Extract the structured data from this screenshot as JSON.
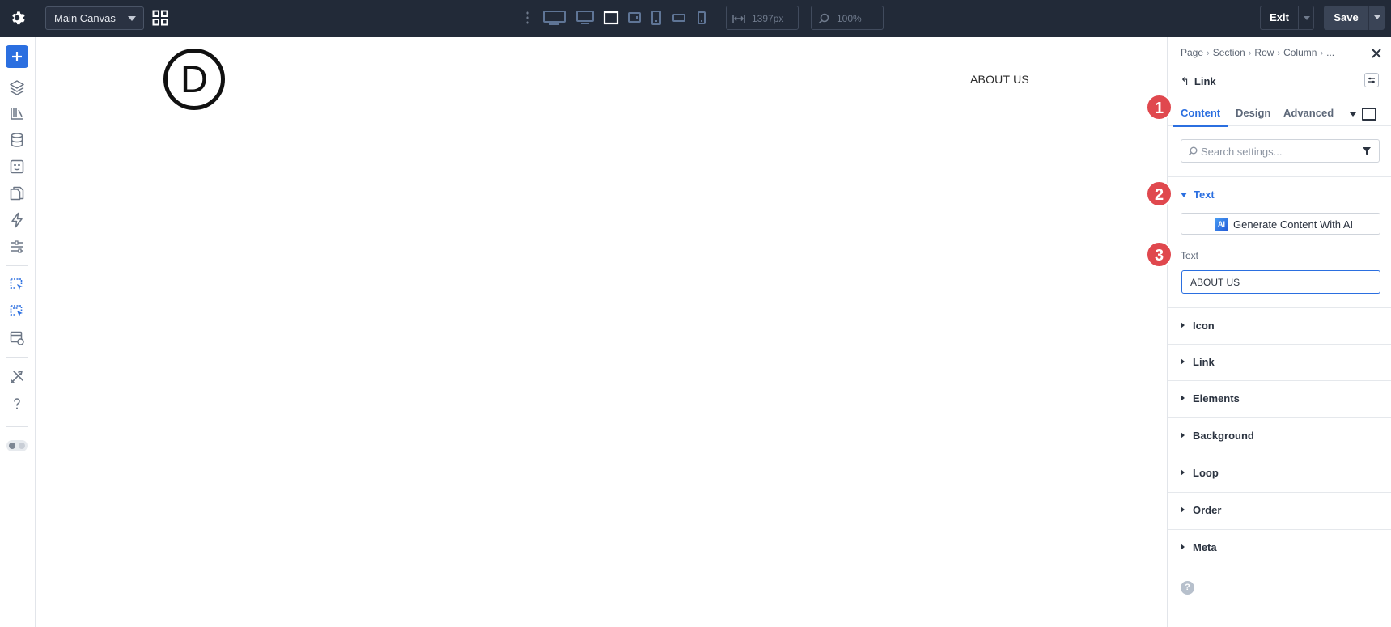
{
  "topbar": {
    "canvas_select": "Main Canvas",
    "width_value": "1397px",
    "zoom_value": "100%",
    "exit_label": "Exit",
    "save_label": "Save",
    "background_color": "#222a38"
  },
  "canvas": {
    "logo_letter": "D",
    "nav_link": "ABOUT US"
  },
  "panel": {
    "breadcrumb": [
      "Page",
      "Section",
      "Row",
      "Column",
      "..."
    ],
    "module_title": "Link",
    "tabs": [
      "Content",
      "Design",
      "Advanced"
    ],
    "active_tab": "Content",
    "search_placeholder": "Search settings...",
    "open_group": "Text",
    "ai_badge": "AI",
    "ai_button": "Generate Content With AI",
    "field_label": "Text",
    "field_value": "ABOUT US",
    "groups": [
      "Icon",
      "Link",
      "Elements",
      "Background",
      "Loop",
      "Order",
      "Meta"
    ],
    "help": "?",
    "accent_color": "#2b6fe0"
  },
  "steps": [
    "1",
    "2",
    "3"
  ],
  "step_color": "#e0484e"
}
